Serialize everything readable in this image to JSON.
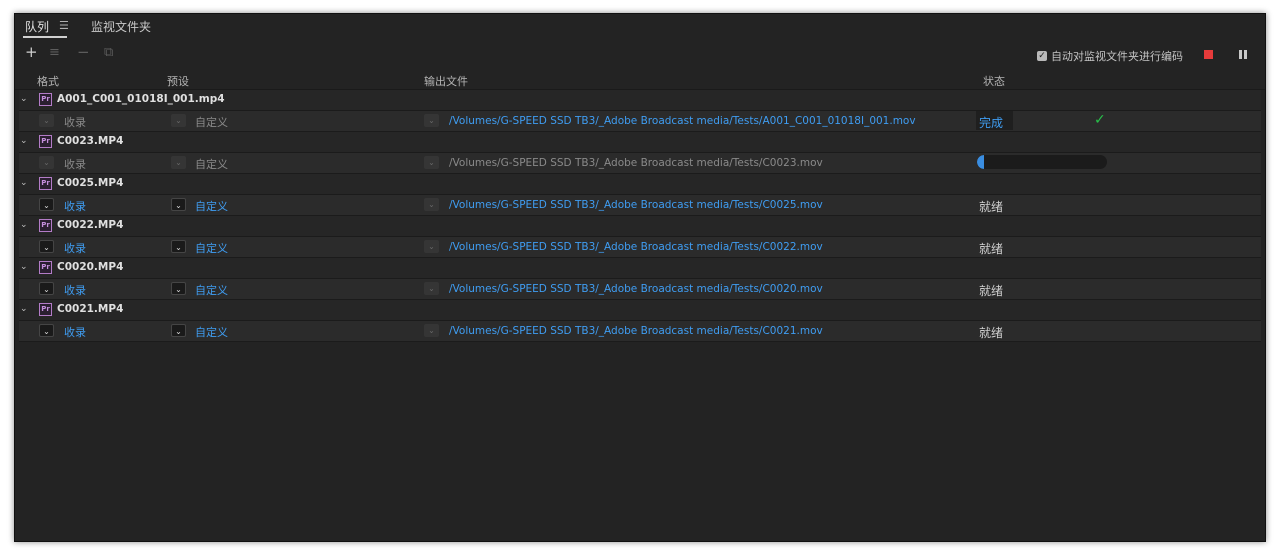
{
  "tabs": {
    "queue": "队列",
    "watch_folders": "监视文件夹"
  },
  "toolbar": {
    "add_icon": "plus-icon",
    "settings_icon": "sliders-icon",
    "remove_icon": "minus-icon",
    "duplicate_icon": "duplicate-icon",
    "auto_encode_label": "自动对监视文件夹进行编码",
    "auto_encode_checked": true
  },
  "columns": {
    "format": "格式",
    "preset": "预设",
    "output": "输出文件",
    "status": "状态"
  },
  "items": [
    {
      "source": "A001_C001_01018I_001.mp4",
      "format": "收录",
      "preset": "自定义",
      "output": "/Volumes/G-SPEED SSD TB3/_Adobe Broadcast media/Tests/A001_C001_01018I_001.mov",
      "status": "完成",
      "state": "done"
    },
    {
      "source": "C0023.MP4",
      "format": "收录",
      "preset": "自定义",
      "output": "/Volumes/G-SPEED SSD TB3/_Adobe Broadcast media/Tests/C0023.mov",
      "status": "",
      "state": "encoding",
      "progress": 0.05
    },
    {
      "source": "C0025.MP4",
      "format": "收录",
      "preset": "自定义",
      "output": "/Volumes/G-SPEED SSD TB3/_Adobe Broadcast media/Tests/C0025.mov",
      "status": "就绪",
      "state": "ready"
    },
    {
      "source": "C0022.MP4",
      "format": "收录",
      "preset": "自定义",
      "output": "/Volumes/G-SPEED SSD TB3/_Adobe Broadcast media/Tests/C0022.mov",
      "status": "就绪",
      "state": "ready"
    },
    {
      "source": "C0020.MP4",
      "format": "收录",
      "preset": "自定义",
      "output": "/Volumes/G-SPEED SSD TB3/_Adobe Broadcast media/Tests/C0020.mov",
      "status": "就绪",
      "state": "ready"
    },
    {
      "source": "C0021.MP4",
      "format": "收录",
      "preset": "自定义",
      "output": "/Volumes/G-SPEED SSD TB3/_Adobe Broadcast media/Tests/C0021.mov",
      "status": "就绪",
      "state": "ready"
    }
  ],
  "colors": {
    "accent": "#3f9df2",
    "success": "#27c04a",
    "stop": "#e63b3b"
  }
}
